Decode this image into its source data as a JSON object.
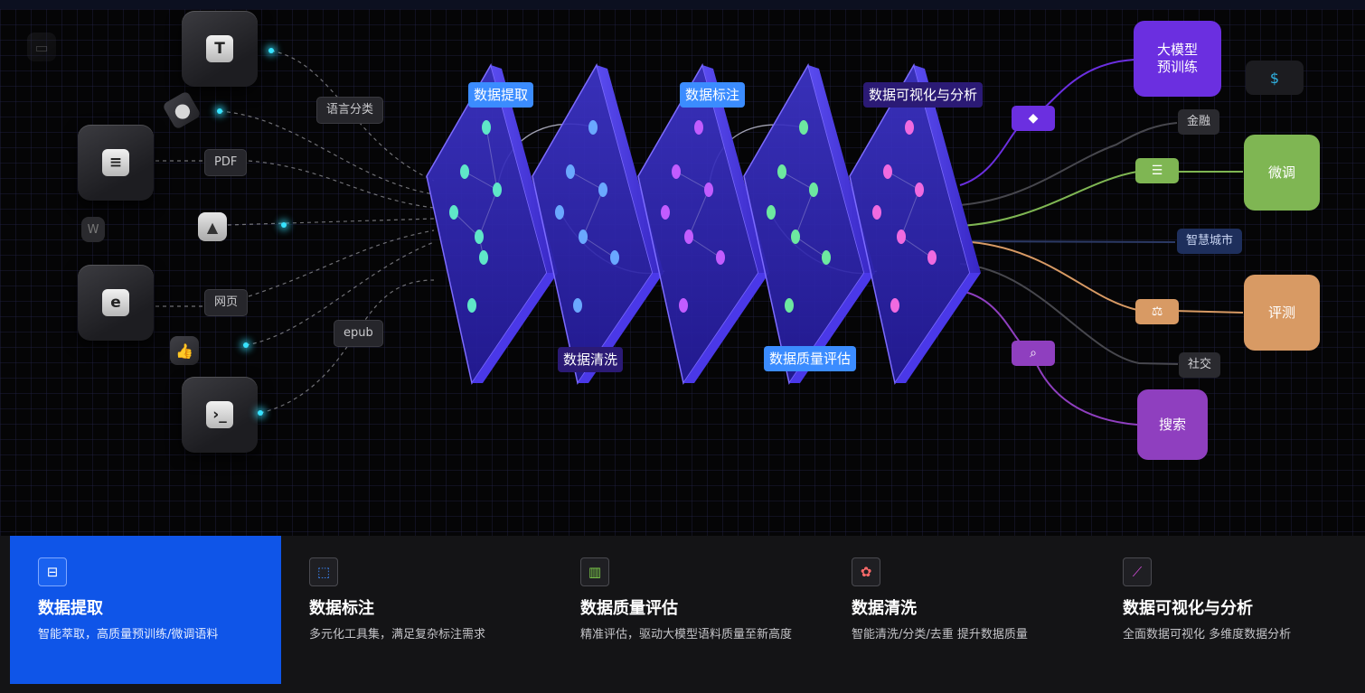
{
  "source_chips": {
    "lang": "语言分类",
    "pdf": "PDF",
    "web": "网页",
    "epub": "epub"
  },
  "stages": {
    "extract": "数据提取",
    "clean": "数据清洗",
    "annotate": "数据标注",
    "quality": "数据质量评估",
    "visualize": "数据可视化与分析"
  },
  "destinations": {
    "pretrain": "大模型\n预训练",
    "finetune": "微调",
    "evaluate": "评测",
    "search": "搜索"
  },
  "right_chips": {
    "finance": "金融",
    "smart_city": "智慧城市",
    "social": "社交"
  },
  "features": [
    {
      "title": "数据提取",
      "desc": "智能萃取，高质量预训练/微调语料",
      "active": true
    },
    {
      "title": "数据标注",
      "desc": "多元化工具集，满足复杂标注需求",
      "active": false
    },
    {
      "title": "数据质量评估",
      "desc": "精准评估，驱动大模型语料质量至新高度",
      "active": false
    },
    {
      "title": "数据清洗",
      "desc": "智能清洗/分类/去重 提升数据质量",
      "active": false
    },
    {
      "title": "数据可视化与分析",
      "desc": "全面数据可视化 多维度数据分析",
      "active": false
    }
  ],
  "colors": {
    "accent": "#0f55e8",
    "purple": "#6b2fe0",
    "green": "#7fb653",
    "orange": "#d89a64",
    "violet": "#8f3fbf"
  }
}
